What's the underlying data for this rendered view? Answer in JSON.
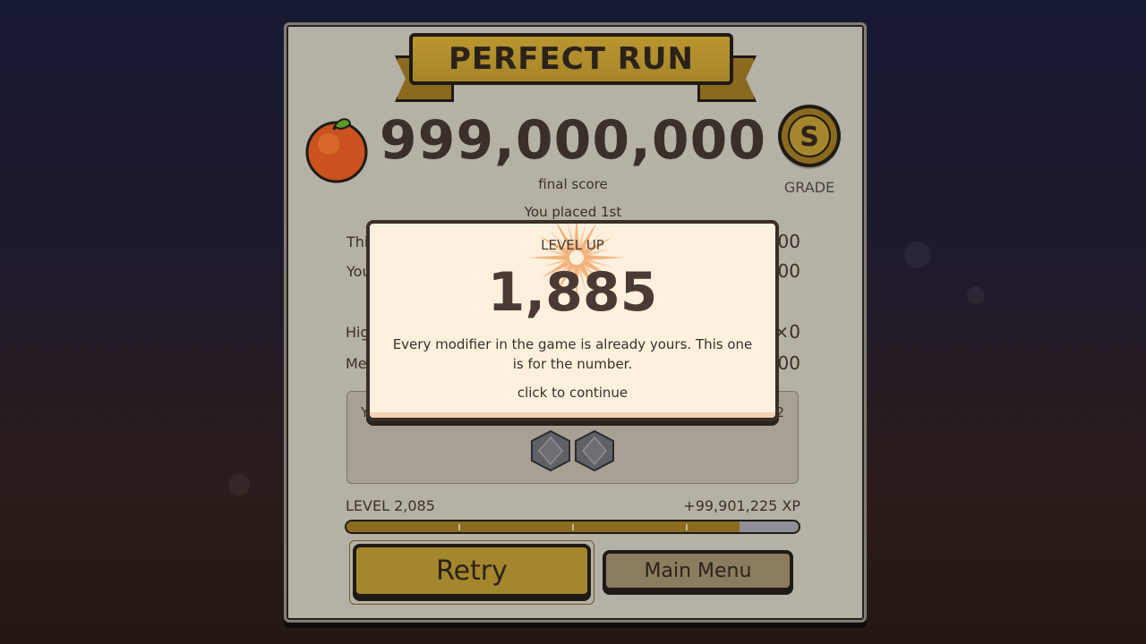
{
  "banner": {
    "title": "PERFECT RUN"
  },
  "score": {
    "value": "999,000,000",
    "label": "final score",
    "placed": "You placed 1st"
  },
  "grade": {
    "letter": "S",
    "label": "GRADE"
  },
  "rows": [
    {
      "label": "Thi",
      "value": "00"
    },
    {
      "label": "You",
      "value": "00"
    },
    {
      "label": "Hig",
      "value": "×0"
    },
    {
      "label": "Mer",
      "value": "00"
    }
  ],
  "modifiers": {
    "left_text": "Y",
    "right_text": "2",
    "icons": [
      "modifier-hex-icon",
      "modifier-hex-icon"
    ]
  },
  "xp": {
    "level_label": "LEVEL 2,085",
    "gain_label": "+99,901,225 XP",
    "progress": 0.87
  },
  "buttons": {
    "retry": "Retry",
    "main_menu": "Main Menu"
  },
  "modal": {
    "heading": "LEVEL UP",
    "level": "1,885",
    "message": "Every modifier in the game is already yours. This one is for the number.",
    "prompt": "click to continue"
  },
  "colors": {
    "gold": "#a4862c",
    "panel": "#c5c0b6",
    "modal": "#fdf0df",
    "text_dark": "#3a3029"
  }
}
